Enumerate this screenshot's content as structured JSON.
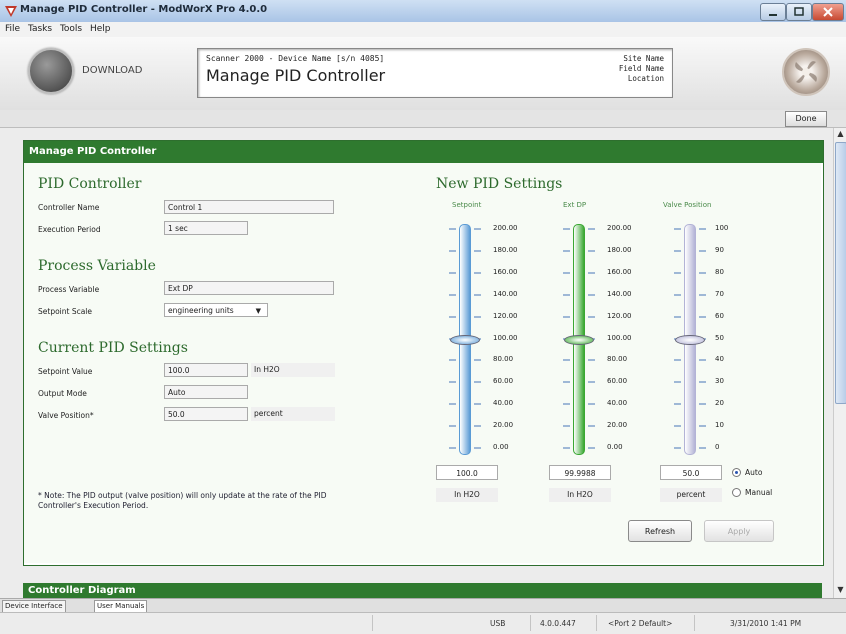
{
  "window": {
    "title": "Manage PID Controller - ModWorX Pro 4.0.0"
  },
  "menu": {
    "items": [
      "File",
      "Tasks",
      "Tools",
      "Help"
    ]
  },
  "header": {
    "download_label": "DOWNLOAD",
    "device_line": "Scanner 2000 - Device Name [s/n 4085]",
    "page_title": "Manage PID Controller",
    "site_name": "Site Name",
    "field_name": "Field Name",
    "location": "Location"
  },
  "toolbar": {
    "done_label": "Done"
  },
  "panel": {
    "title": "Manage PID Controller"
  },
  "pid_controller": {
    "heading": "PID Controller",
    "name_label": "Controller Name",
    "name_value": "Control 1",
    "period_label": "Execution Period",
    "period_value": "1 sec"
  },
  "process_variable": {
    "heading": "Process Variable",
    "pv_label": "Process Variable",
    "pv_value": "Ext DP",
    "scale_label": "Setpoint Scale",
    "scale_value": "engineering units"
  },
  "current_settings": {
    "heading": "Current PID Settings",
    "setpoint_label": "Setpoint Value",
    "setpoint_value": "100.0",
    "setpoint_unit": "In H2O",
    "output_label": "Output Mode",
    "output_value": "Auto",
    "valve_label": "Valve Position*",
    "valve_value": "50.0",
    "valve_unit": "percent"
  },
  "note": "* Note: The PID output (valve position) will only update at the rate of the PID Controller's Execution Period.",
  "new_settings": {
    "heading": "New PID Settings",
    "sliders": [
      {
        "title": "Setpoint",
        "ticks": [
          "200.00",
          "180.00",
          "160.00",
          "140.00",
          "120.00",
          "100.00",
          "80.00",
          "60.00",
          "40.00",
          "20.00",
          "0.00"
        ],
        "value": "100.0",
        "unit": "In H2O",
        "fraction": 0.5,
        "color": "#5b9bd5"
      },
      {
        "title": "Ext DP",
        "ticks": [
          "200.00",
          "180.00",
          "160.00",
          "140.00",
          "120.00",
          "100.00",
          "80.00",
          "60.00",
          "40.00",
          "20.00",
          "0.00"
        ],
        "value": "99.9988",
        "unit": "In H2O",
        "fraction": 0.5,
        "color": "#3aa832"
      },
      {
        "title": "Valve Position",
        "ticks": [
          "100",
          "90",
          "80",
          "70",
          "60",
          "50",
          "40",
          "30",
          "20",
          "10",
          "0"
        ],
        "value": "50.0",
        "unit": "percent",
        "fraction": 0.5,
        "color": "#b3b3d6"
      }
    ],
    "mode_auto": "Auto",
    "mode_manual": "Manual",
    "mode_selected": "Auto",
    "refresh_label": "Refresh",
    "apply_label": "Apply"
  },
  "diagram": {
    "title": "Controller Diagram"
  },
  "tabs": [
    "Device Interface",
    "User Manuals"
  ],
  "status": {
    "connection": "USB",
    "version": "4.0.0.447",
    "port": "<Port 2 Default>",
    "datetime": "3/31/2010 1:41 PM"
  }
}
